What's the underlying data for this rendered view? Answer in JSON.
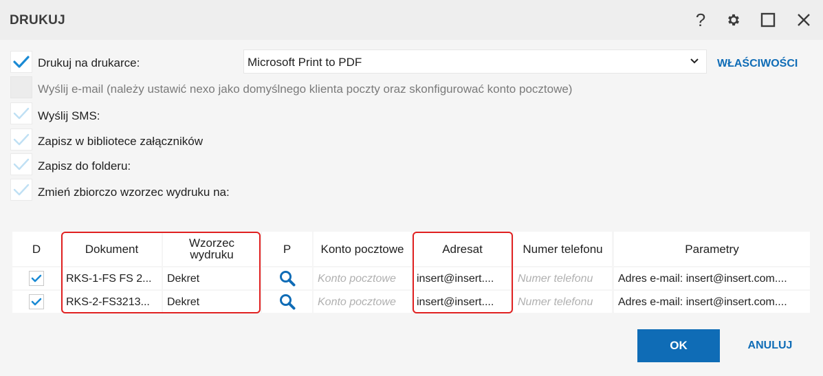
{
  "window": {
    "title": "DRUKUJ"
  },
  "colors": {
    "accent": "#0f6cb6",
    "highlight": "#e02020",
    "check": "#1a8ad4"
  },
  "options": {
    "print": {
      "label": "Drukuj na drukarce:",
      "checked": true
    },
    "printer": {
      "selected": "Microsoft Print to PDF"
    },
    "properties_link": "WŁAŚCIWOŚCI",
    "email": {
      "label": "Wyślij e-mail (należy ustawić nexo jako domyślnego klienta poczty oraz skonfigurować konto pocztowe)",
      "disabled": true
    },
    "sms": {
      "label": "Wyślij SMS:"
    },
    "library": {
      "label": "Zapisz w bibliotece załączników"
    },
    "folder": {
      "label": "Zapisz do folderu:"
    },
    "template": {
      "label": "Zmień zbiorczo wzorzec wydruku na:"
    }
  },
  "table": {
    "columns": {
      "d": "D",
      "document": "Dokument",
      "template": "Wzorzec wydruku",
      "p": "P",
      "account": "Konto pocztowe",
      "recipient": "Adresat",
      "phone": "Numer telefonu",
      "params": "Parametry"
    },
    "rows": [
      {
        "checked": true,
        "document": "RKS-1-FS FS 2...",
        "template": "Dekret",
        "account": "Konto pocztowe",
        "recipient": "insert@insert....",
        "phone": "Numer telefonu",
        "params": "Adres e-mail: insert@insert.com...."
      },
      {
        "checked": true,
        "document": "RKS-2-FS3213...",
        "template": "Dekret",
        "account": "Konto pocztowe",
        "recipient": "insert@insert....",
        "phone": "Numer telefonu",
        "params": "Adres e-mail: insert@insert.com...."
      }
    ]
  },
  "buttons": {
    "ok": "OK",
    "cancel": "ANULUJ"
  }
}
